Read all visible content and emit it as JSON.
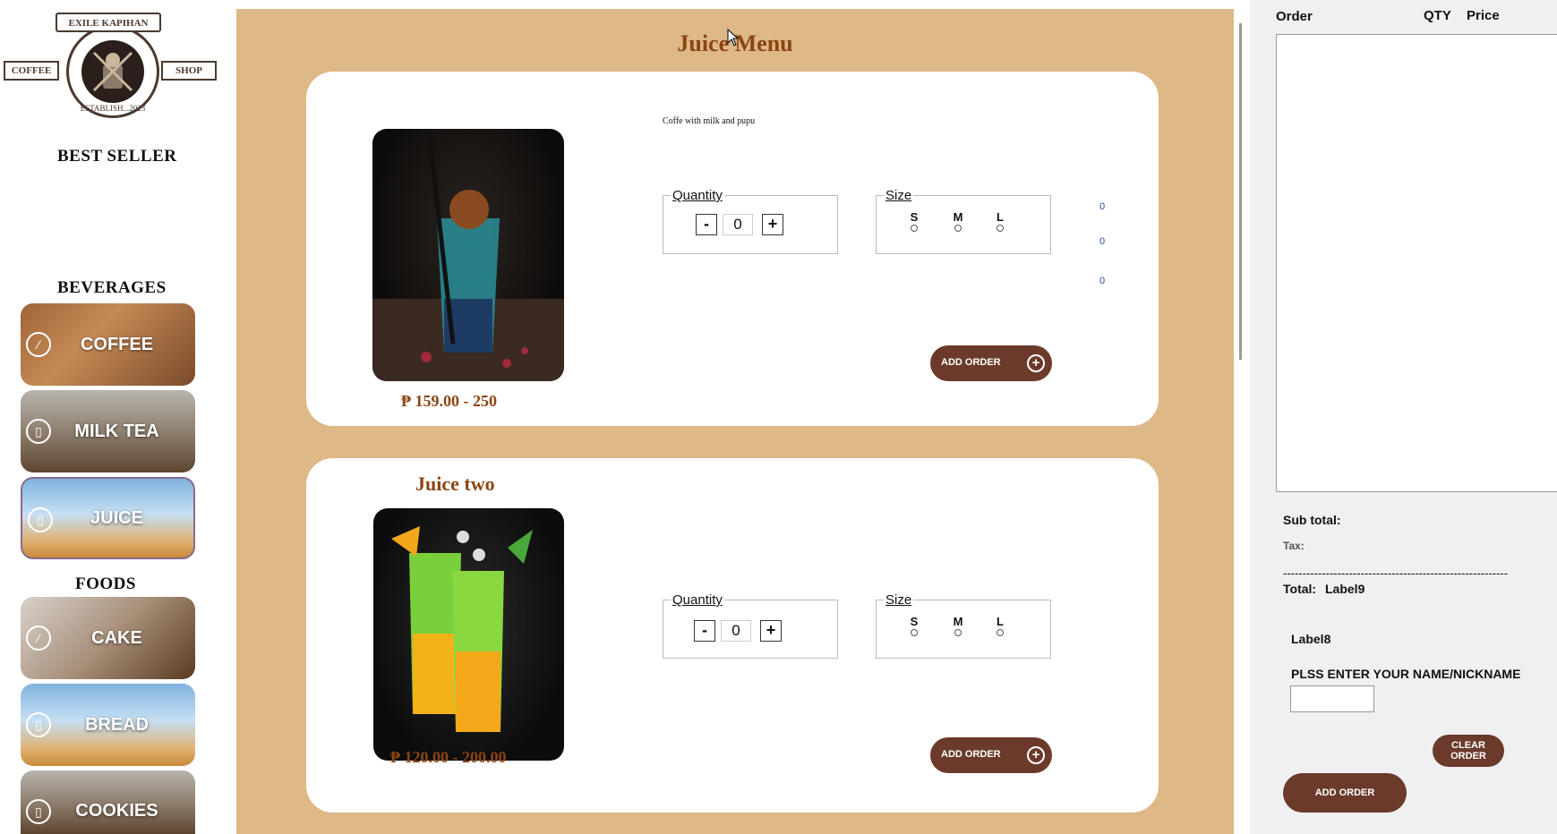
{
  "sidebar": {
    "logo": {
      "top_text": "EXILE KAPIHAN",
      "left_text": "COFFEE",
      "right_text": "SHOP",
      "bottom_text": "ESTABLISH...2023"
    },
    "best_seller": "BEST SELLER",
    "beverages_heading": "BEVERAGES",
    "foods_heading": "FOODS",
    "beverages": [
      {
        "label": "COFFEE"
      },
      {
        "label": "MILK TEA"
      },
      {
        "label": "JUICE"
      }
    ],
    "foods": [
      {
        "label": "CAKE"
      },
      {
        "label": "BREAD"
      },
      {
        "label": "COOKIES"
      }
    ]
  },
  "main": {
    "title": "Juice Menu",
    "products": [
      {
        "name": "",
        "description": "Coffe with milk and pupu",
        "price": "₱ 159.00 - 250",
        "quantity_legend": "Quantity",
        "quantity_minus": "-",
        "quantity_value": "0",
        "quantity_plus": "+",
        "size_legend": "Size",
        "sizes": [
          "S",
          "M",
          "L"
        ],
        "prices": [
          "0",
          "0",
          "0"
        ],
        "add_label": "ADD ORDER"
      },
      {
        "name": "Juice two",
        "price": "₱ 120.00 - 200.00",
        "quantity_legend": "Quantity",
        "quantity_minus": "-",
        "quantity_value": "0",
        "quantity_plus": "+",
        "size_legend": "Size",
        "sizes": [
          "S",
          "M",
          "L"
        ],
        "add_label": "ADD ORDER"
      }
    ]
  },
  "order_panel": {
    "order_header": "Order",
    "qty_header": "QTY",
    "price_header": "Price",
    "subtotal_label": "Sub total:",
    "tax_label": "Tax:",
    "divider": "----------------------------------------------------------",
    "total_label": "Total:",
    "total_value": "Label9",
    "label8": "Label8",
    "name_prompt": "PLSS ENTER YOUR NAME/NICKNAME",
    "name_value": "",
    "clear_label": "CLEAR ORDER",
    "add_order_label": "ADD ORDER"
  }
}
